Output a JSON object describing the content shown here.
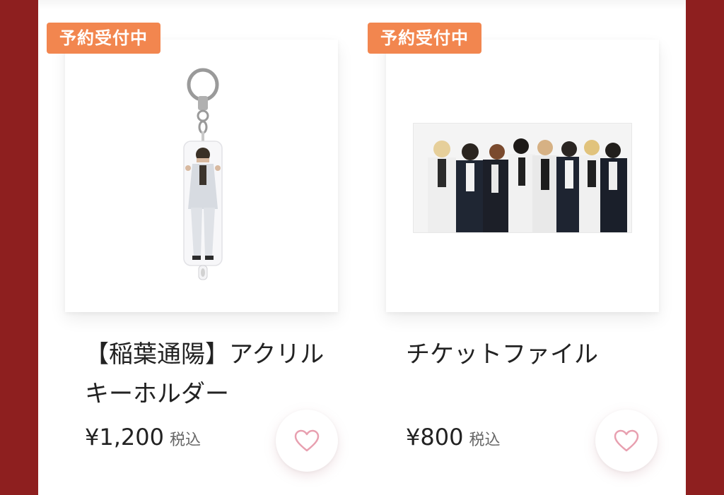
{
  "products": [
    {
      "badge": "予約受付中",
      "title": "【稲葉通陽】アクリルキーホルダー",
      "price": "¥1,200",
      "tax_label": "税込",
      "image_icon": "acrylic-keychain-image"
    },
    {
      "badge": "予約受付中",
      "title": "チケットファイル",
      "price": "¥800",
      "tax_label": "税込",
      "image_icon": "group-photo-image"
    }
  ],
  "colors": {
    "page_background": "#8e1f1f",
    "badge": "#f2864f",
    "heart": "#e8a0b0",
    "text": "#222222"
  }
}
